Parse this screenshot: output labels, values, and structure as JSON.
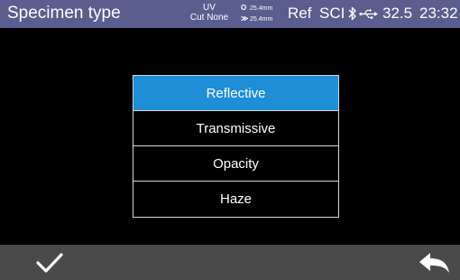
{
  "status_bar": {
    "title": "Specimen type",
    "uv": "UV",
    "uv_filter": "Cut None",
    "aperture_measure": "25.4mm",
    "aperture_illum": "25.4mm",
    "mode": "Ref",
    "specular": "SCI",
    "temperature": "32.5",
    "time": "23:32",
    "background_color": "#5a5d8e"
  },
  "menu": {
    "items": [
      {
        "label": "Reflective",
        "selected": true
      },
      {
        "label": "Transmissive",
        "selected": false
      },
      {
        "label": "Opacity",
        "selected": false
      },
      {
        "label": "Haze",
        "selected": false
      }
    ],
    "selected_color": "#1e8ed6"
  },
  "bottom_bar": {
    "confirm_icon": "checkmark-icon",
    "back_icon": "back-arrow-icon",
    "background_color": "#4a4a4a"
  }
}
